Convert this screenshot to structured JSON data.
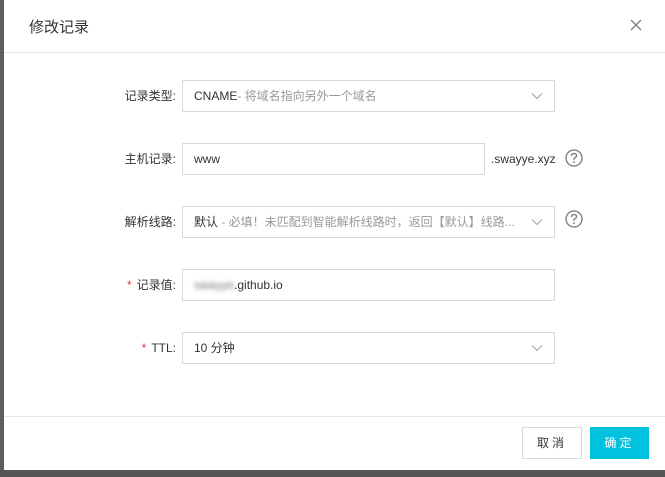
{
  "dialog": {
    "title": "修改记录",
    "close_icon": "close-icon"
  },
  "form": {
    "record_type": {
      "label": "记录类型:",
      "value_main": "CNAME",
      "value_desc": "- 将域名指向另外一个域名"
    },
    "host_record": {
      "label": "主机记录:",
      "value": "www",
      "suffix": ".swayye.xyz"
    },
    "route_line": {
      "label": "解析线路:",
      "value_main": "默认",
      "value_desc": " - 必填！未匹配到智能解析线路时，返回【默认】线路..."
    },
    "record_value": {
      "required_mark": "*",
      "label": "记录值:",
      "value_blurred": "swayye",
      "value_visible": ".github.io"
    },
    "ttl": {
      "required_mark": "*",
      "label": "TTL:",
      "value": "10 分钟"
    }
  },
  "footer": {
    "cancel_label": "取消",
    "ok_label": "确定"
  },
  "colors": {
    "primary": "#00c1de",
    "required": "#e4393c",
    "border": "#d9d9d9"
  }
}
